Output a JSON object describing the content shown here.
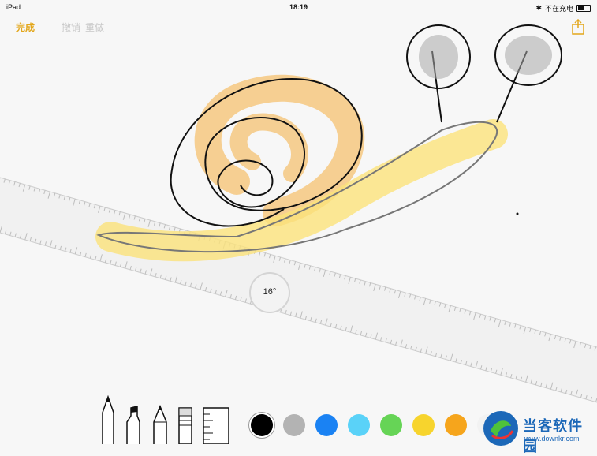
{
  "status": {
    "device": "iPad",
    "time": "18:19",
    "charging_text": "不在充电"
  },
  "toolbar": {
    "done_label": "完成",
    "undo_label": "撤销",
    "redo_label": "重做"
  },
  "ruler": {
    "angle": "16°"
  },
  "tools": [
    "pen-icon",
    "marker-icon",
    "pencil-icon",
    "eraser-icon",
    "ruler-icon"
  ],
  "colors": [
    "#000000",
    "#b3b3b3",
    "#1a82f3",
    "#5ad2f8",
    "#66d456",
    "#f7d42d",
    "#f6a51c",
    "#f2f2f2"
  ],
  "watermark": {
    "title": "当客软件园",
    "url": "www.downkr.com"
  }
}
